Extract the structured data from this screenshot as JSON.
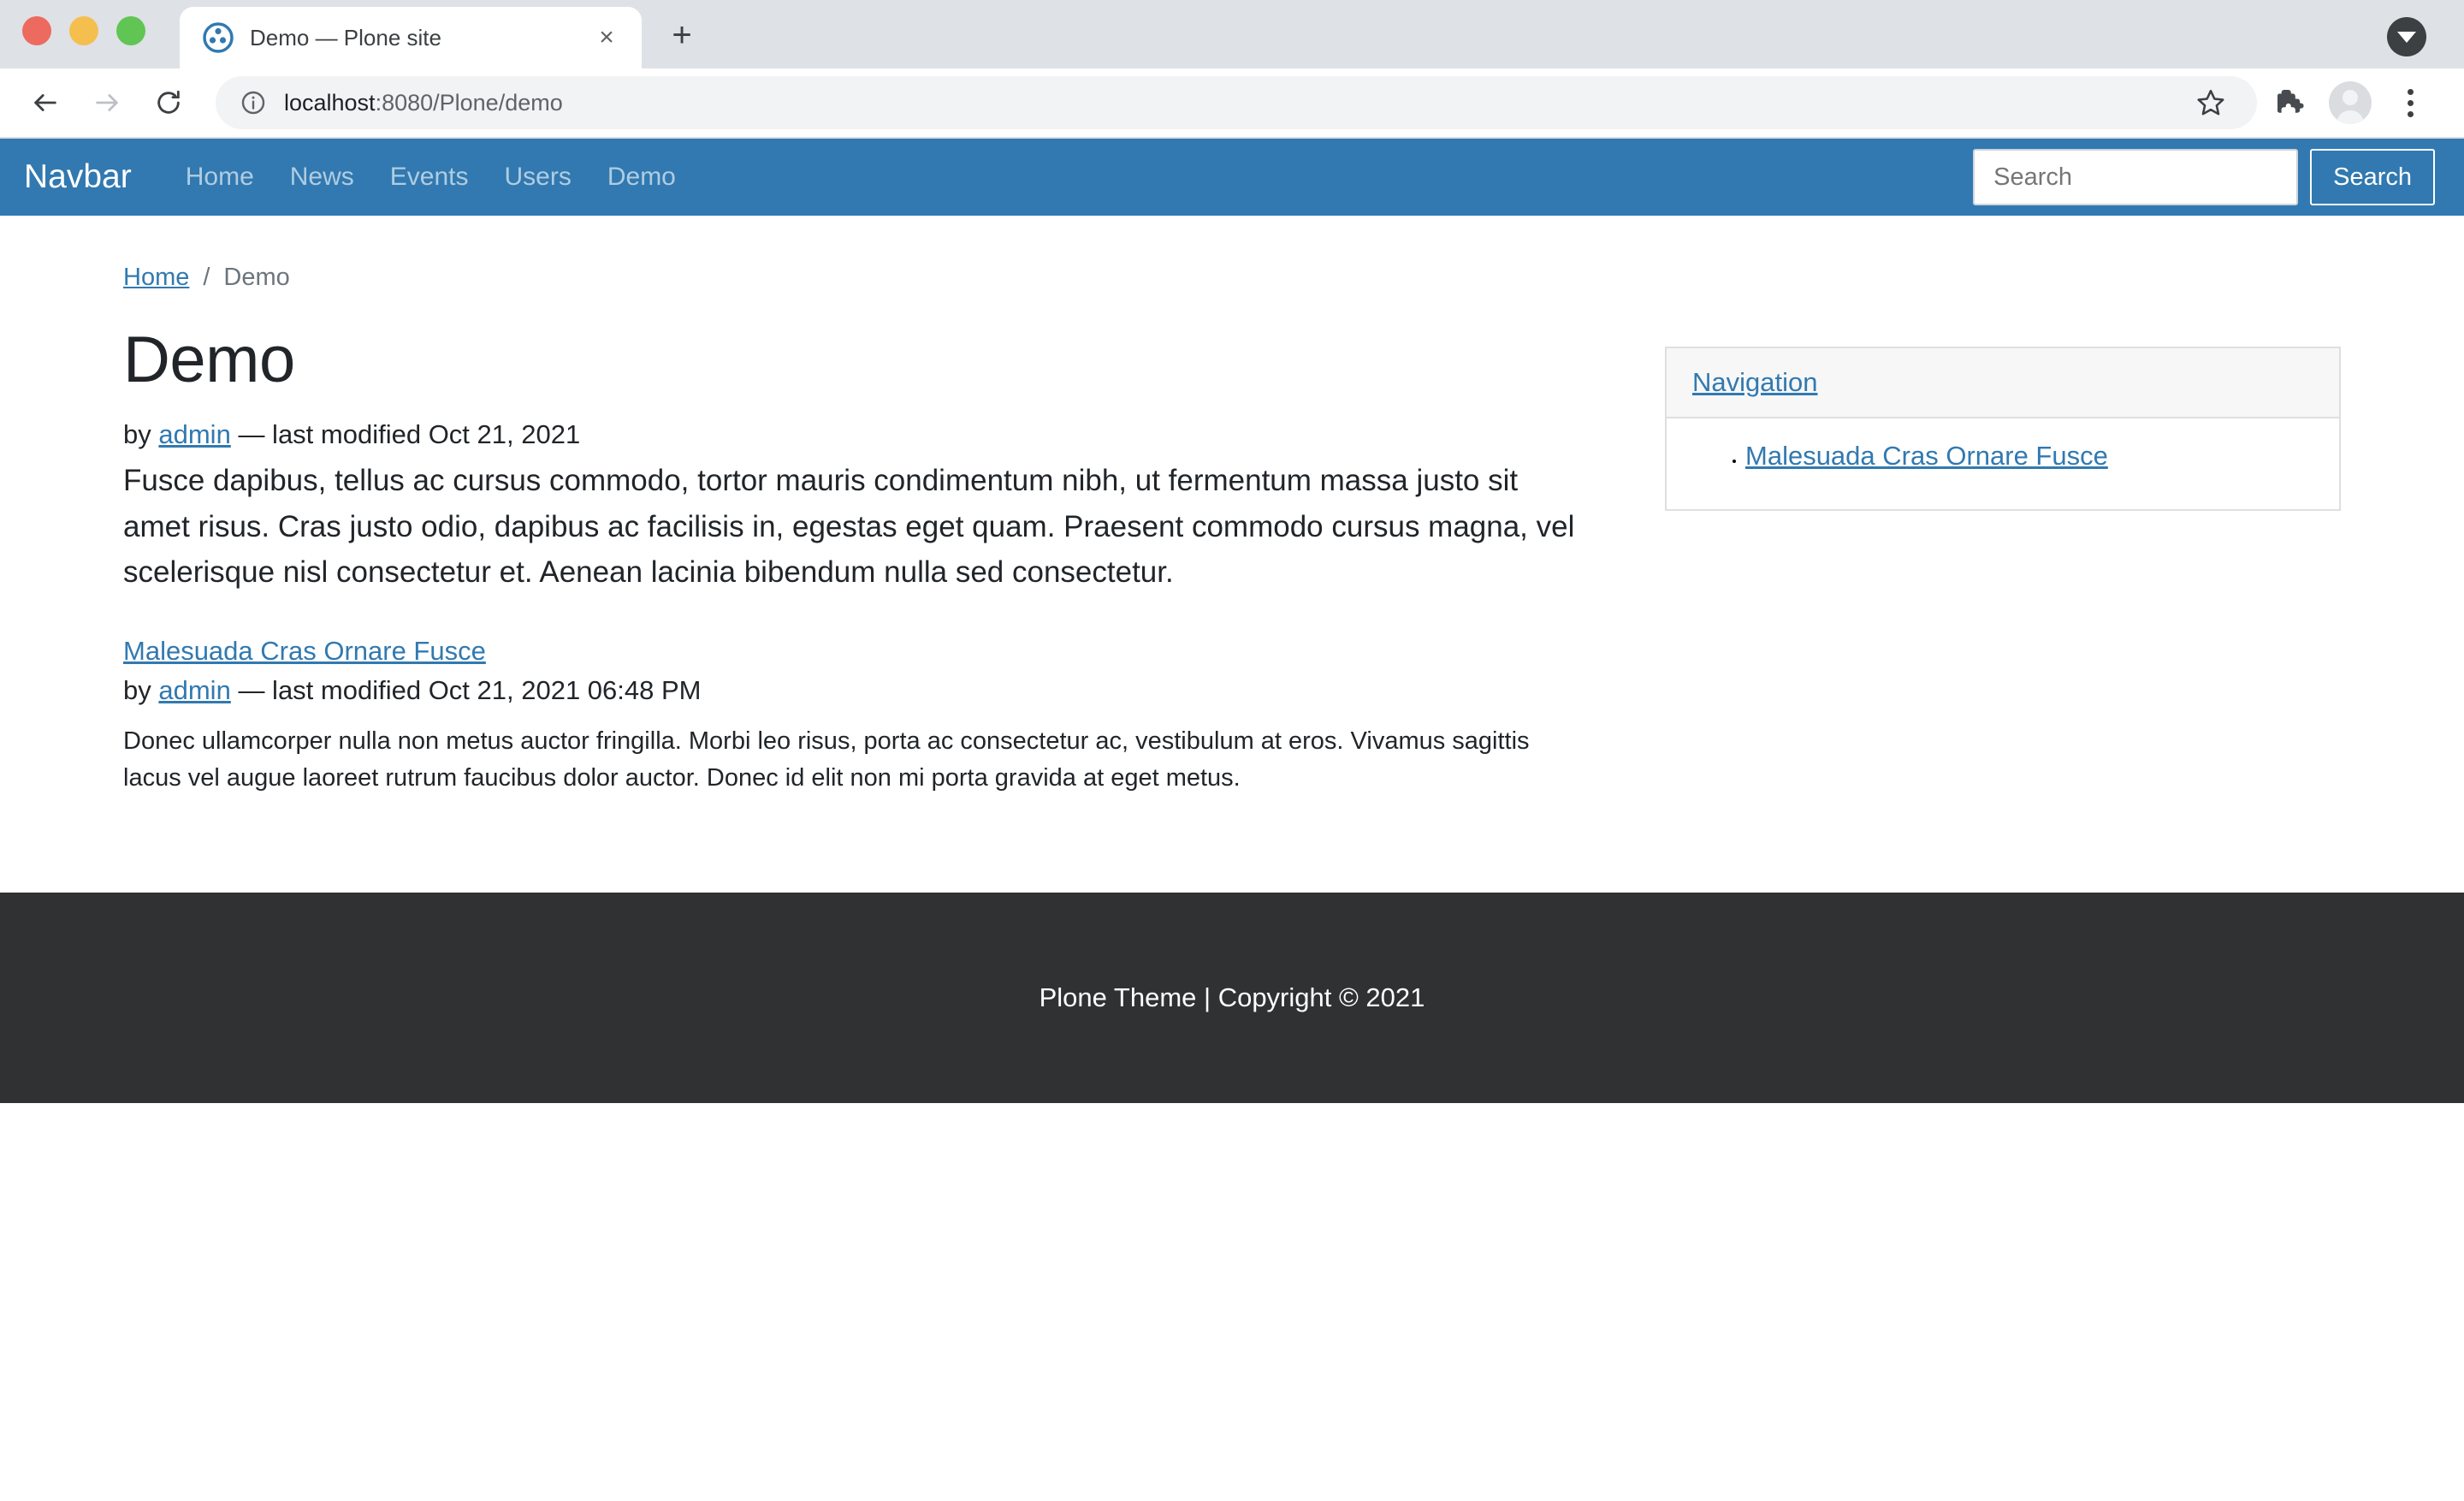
{
  "browser": {
    "tab": {
      "title": "Demo — Plone site",
      "favicon_name": "plone-favicon",
      "close_label": "×"
    },
    "new_tab_label": "+",
    "toolbar": {
      "back_label": "←",
      "forward_label": "→",
      "reload_label": "↻",
      "url": "localhost",
      "url_path": ":8080/Plone/demo",
      "url_full": "localhost:8080/Plone/demo"
    }
  },
  "navbar": {
    "brand": "Navbar",
    "links": [
      {
        "label": "Home"
      },
      {
        "label": "News"
      },
      {
        "label": "Events"
      },
      {
        "label": "Users"
      },
      {
        "label": "Demo"
      }
    ],
    "search_placeholder": "Search",
    "search_value": "",
    "search_button": "Search",
    "bg_color": "#3179b0"
  },
  "breadcrumb": {
    "home": "Home",
    "separator": "/",
    "current": "Demo"
  },
  "content": {
    "title": "Demo",
    "byline_prefix": "by",
    "byline_author": "admin",
    "byline_suffix": "— last modified Oct 21, 2021",
    "lead": "Fusce dapibus, tellus ac cursus commodo, tortor mauris condimentum nibh, ut fermentum massa justo sit amet risus. Cras justo odio, dapibus ac facilisis in, egestas eget quam. Praesent commodo cursus magna, vel scelerisque nisl consectetur et. Aenean lacinia bibendum nulla sed consectetur.",
    "items": [
      {
        "title": "Malesuada Cras Ornare Fusce",
        "byline_prefix": "by",
        "byline_author": "admin",
        "byline_suffix": "— last modified Oct 21, 2021 06:48 PM",
        "description": "Donec ullamcorper nulla non metus auctor fringilla. Morbi leo risus, porta ac consectetur ac, vestibulum at eros. Vivamus sagittis lacus vel augue laoreet rutrum faucibus dolor auctor. Donec id elit non mi porta gravida at eget metus."
      }
    ]
  },
  "portlet": {
    "header": "Navigation",
    "items": [
      {
        "label": "Malesuada Cras Ornare Fusce"
      }
    ]
  },
  "footer": {
    "text": "Plone Theme | Copyright © 2021"
  }
}
